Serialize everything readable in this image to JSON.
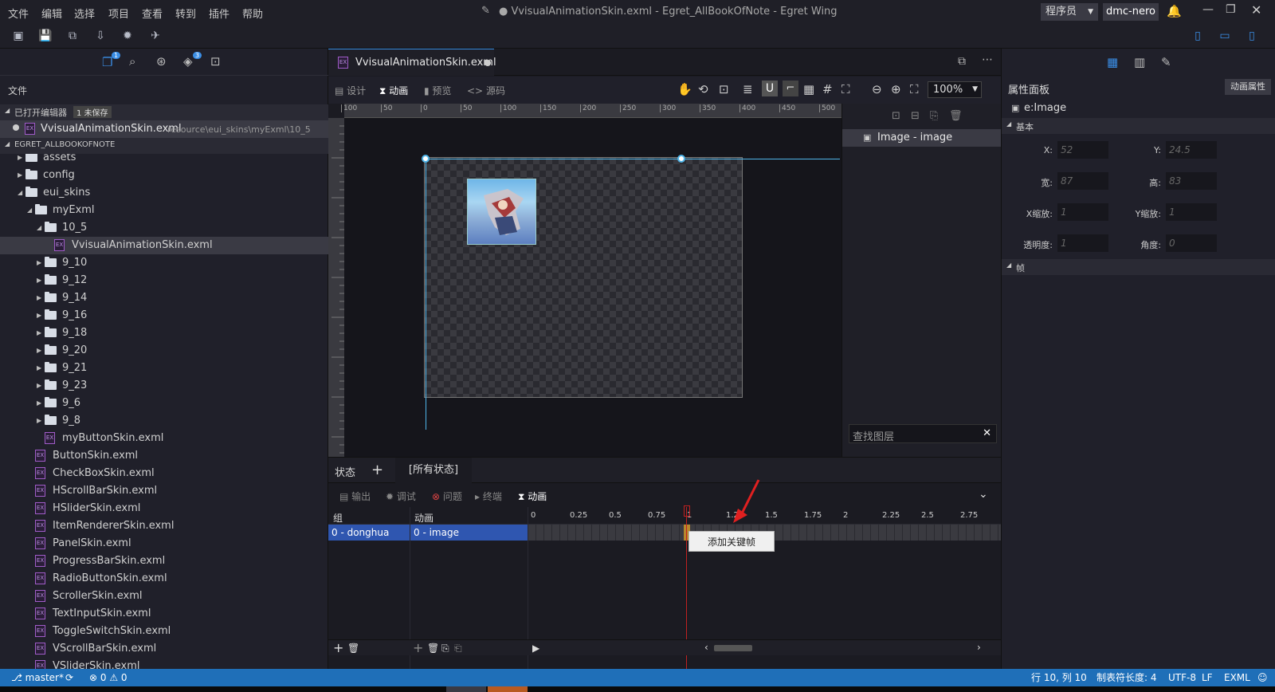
{
  "titlebar": {
    "menus": [
      "文件",
      "编辑",
      "选择",
      "项目",
      "查看",
      "转到",
      "插件",
      "帮助"
    ],
    "window_title": "● VvisualAnimationSkin.exml - Egret_AllBookOfNote - Egret Wing",
    "role_label": "程序员",
    "user_label": "dmc-nero"
  },
  "sidebar": {
    "section_label": "文件",
    "open_editors_label": "已打开编辑器",
    "unsaved_badge": "1 未保存",
    "open_file_name": "VvisualAnimationSkin.exml",
    "open_file_path": "resource\\eui_skins\\myExml\\10_5",
    "project_label": "EGRET_ALLBOOKOFNOTE",
    "explorer_badge": "1",
    "git_badge": "3",
    "tree": [
      {
        "label": "assets",
        "type": "folder",
        "indent": 1,
        "caret": "closed"
      },
      {
        "label": "config",
        "type": "folder",
        "indent": 1,
        "caret": "closed"
      },
      {
        "label": "eui_skins",
        "type": "folder",
        "indent": 1,
        "caret": "open"
      },
      {
        "label": "myExml",
        "type": "folder",
        "indent": 2,
        "caret": "open"
      },
      {
        "label": "10_5",
        "type": "folder",
        "indent": 3,
        "caret": "open"
      },
      {
        "label": "VvisualAnimationSkin.exml",
        "type": "file",
        "indent": 4,
        "caret": "",
        "selected": true
      },
      {
        "label": "9_10",
        "type": "folder",
        "indent": 3,
        "caret": "closed"
      },
      {
        "label": "9_12",
        "type": "folder",
        "indent": 3,
        "caret": "closed"
      },
      {
        "label": "9_14",
        "type": "folder",
        "indent": 3,
        "caret": "closed"
      },
      {
        "label": "9_16",
        "type": "folder",
        "indent": 3,
        "caret": "closed"
      },
      {
        "label": "9_18",
        "type": "folder",
        "indent": 3,
        "caret": "closed"
      },
      {
        "label": "9_20",
        "type": "folder",
        "indent": 3,
        "caret": "closed"
      },
      {
        "label": "9_21",
        "type": "folder",
        "indent": 3,
        "caret": "closed"
      },
      {
        "label": "9_23",
        "type": "folder",
        "indent": 3,
        "caret": "closed"
      },
      {
        "label": "9_6",
        "type": "folder",
        "indent": 3,
        "caret": "closed"
      },
      {
        "label": "9_8",
        "type": "folder",
        "indent": 3,
        "caret": "closed"
      },
      {
        "label": "myButtonSkin.exml",
        "type": "file",
        "indent": 3,
        "caret": ""
      },
      {
        "label": "ButtonSkin.exml",
        "type": "file",
        "indent": 2,
        "caret": ""
      },
      {
        "label": "CheckBoxSkin.exml",
        "type": "file",
        "indent": 2,
        "caret": ""
      },
      {
        "label": "HScrollBarSkin.exml",
        "type": "file",
        "indent": 2,
        "caret": ""
      },
      {
        "label": "HSliderSkin.exml",
        "type": "file",
        "indent": 2,
        "caret": ""
      },
      {
        "label": "ItemRendererSkin.exml",
        "type": "file",
        "indent": 2,
        "caret": ""
      },
      {
        "label": "PanelSkin.exml",
        "type": "file",
        "indent": 2,
        "caret": ""
      },
      {
        "label": "ProgressBarSkin.exml",
        "type": "file",
        "indent": 2,
        "caret": ""
      },
      {
        "label": "RadioButtonSkin.exml",
        "type": "file",
        "indent": 2,
        "caret": ""
      },
      {
        "label": "ScrollerSkin.exml",
        "type": "file",
        "indent": 2,
        "caret": ""
      },
      {
        "label": "TextInputSkin.exml",
        "type": "file",
        "indent": 2,
        "caret": ""
      },
      {
        "label": "ToggleSwitchSkin.exml",
        "type": "file",
        "indent": 2,
        "caret": ""
      },
      {
        "label": "VScrollBarSkin.exml",
        "type": "file",
        "indent": 2,
        "caret": ""
      },
      {
        "label": "VSliderSkin.exml",
        "type": "file",
        "indent": 2,
        "caret": ""
      }
    ]
  },
  "editor": {
    "tab_label": "VvisualAnimationSkin.exml",
    "modes": {
      "design": "设计",
      "animation": "动画",
      "preview": "预览",
      "source": "源码"
    },
    "zoom": "100%",
    "ruler_ticks": [
      "100",
      "50",
      "0",
      "50",
      "100",
      "150",
      "200",
      "250",
      "300",
      "350",
      "400",
      "450",
      "500"
    ]
  },
  "layers": {
    "item_label": "Image - image",
    "search_placeholder": "查找图层"
  },
  "props": {
    "title": "属性面板",
    "anim_props_button": "动画属性",
    "element_label": "e:Image",
    "section_basic": "基本",
    "section_frame": "帧",
    "x_label": "X:",
    "x_value": "52",
    "y_label": "Y:",
    "y_value": "24.5",
    "w_label": "宽:",
    "w_value": "87",
    "h_label": "高:",
    "h_value": "83",
    "sx_label": "X缩放:",
    "sx_value": "1",
    "sy_label": "Y缩放:",
    "sy_value": "1",
    "alpha_label": "透明度:",
    "alpha_value": "1",
    "rot_label": "角度:",
    "rot_value": "0"
  },
  "bottom": {
    "state_label": "状态",
    "add_label": "+",
    "all_states_tab": "[所有状态]",
    "tabs": {
      "output": "输出",
      "debug": "调试",
      "problems": "问题",
      "terminal": "终端",
      "animation": "动画"
    },
    "col_group": "组",
    "col_anim": "动画",
    "group_row": "0 - donghua",
    "anim_row": "0 - image",
    "time_ticks": [
      "0",
      "0.25",
      "0.5",
      "0.75",
      "1",
      "1.25",
      "1.5",
      "1.75",
      "2",
      "2.25",
      "2.5",
      "2.75"
    ],
    "context_menu_item": "添加关键帧"
  },
  "statusbar": {
    "branch": "master*",
    "errors": "0",
    "warnings": "0",
    "position": "行 10, 列 10",
    "tab_size": "制表符长度: 4",
    "encoding": "UTF-8",
    "eol": "LF",
    "language": "EXML"
  }
}
